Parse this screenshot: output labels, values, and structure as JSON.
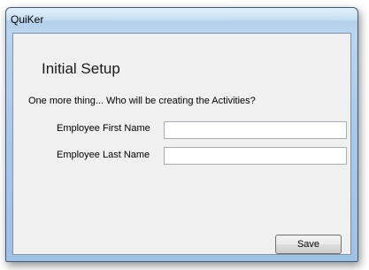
{
  "window": {
    "title": "QuiKer"
  },
  "setup": {
    "heading": "Initial Setup",
    "prompt": "One more thing... Who will be creating the Activities?",
    "first_name_label": "Employee First Name",
    "first_name_value": "",
    "last_name_label": "Employee Last Name",
    "last_name_value": "",
    "save_label": "Save"
  }
}
